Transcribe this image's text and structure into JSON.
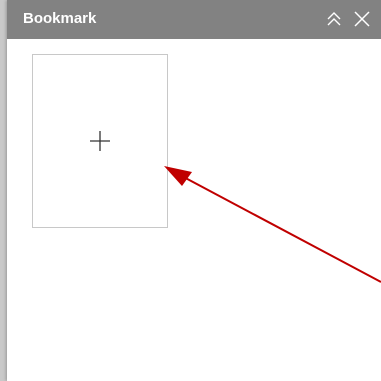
{
  "panel": {
    "title": "Bookmark"
  },
  "icons": {
    "collapse": "double-chevron-up-icon",
    "close": "close-icon",
    "add": "plus-icon"
  },
  "colors": {
    "titlebar": "#828282",
    "annotation_arrow": "#c00000",
    "card_border": "#c8c8c8"
  }
}
